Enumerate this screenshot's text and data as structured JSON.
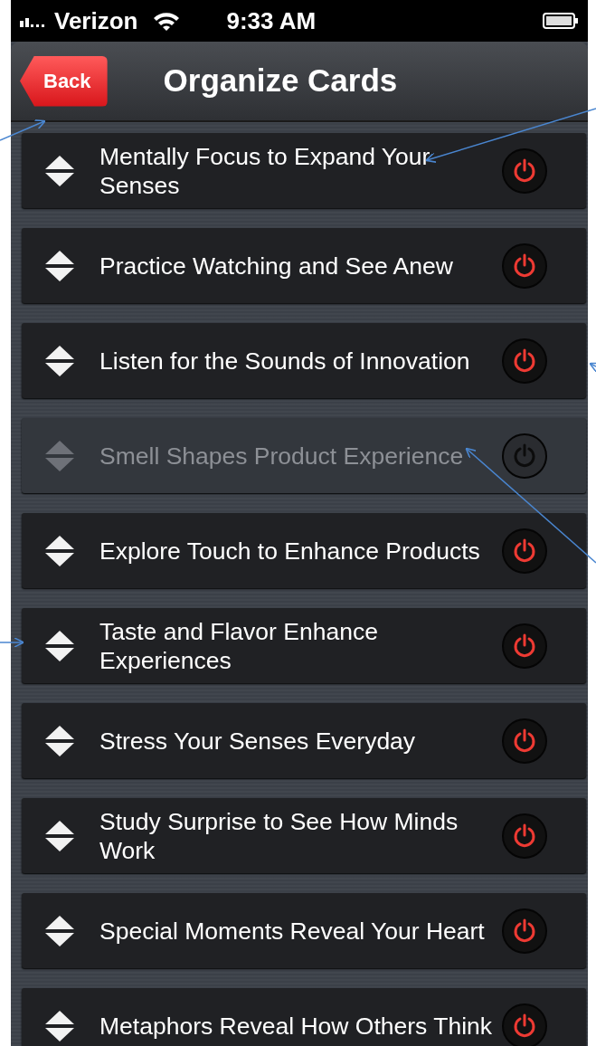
{
  "status_bar": {
    "carrier": "Verizon",
    "time": "9:33 AM"
  },
  "nav_bar": {
    "back": "Back",
    "title": "Organize Cards"
  },
  "cards": [
    {
      "title": "Mentally Focus to Expand Your Senses",
      "enabled": true
    },
    {
      "title": "Practice Watching and See Anew",
      "enabled": true
    },
    {
      "title": "Listen for the Sounds of Innovation",
      "enabled": true
    },
    {
      "title": "Smell Shapes Product Experience",
      "enabled": false
    },
    {
      "title": "Explore Touch to Enhance Products",
      "enabled": true
    },
    {
      "title": "Taste and Flavor Enhance Experiences",
      "enabled": true
    },
    {
      "title": "Stress Your Senses Everyday",
      "enabled": true
    },
    {
      "title": "Study Surprise to See How Minds Work",
      "enabled": true
    },
    {
      "title": "Special Moments Reveal Your Heart",
      "enabled": true
    },
    {
      "title": "Metaphors Reveal How Others Think",
      "enabled": true
    }
  ]
}
